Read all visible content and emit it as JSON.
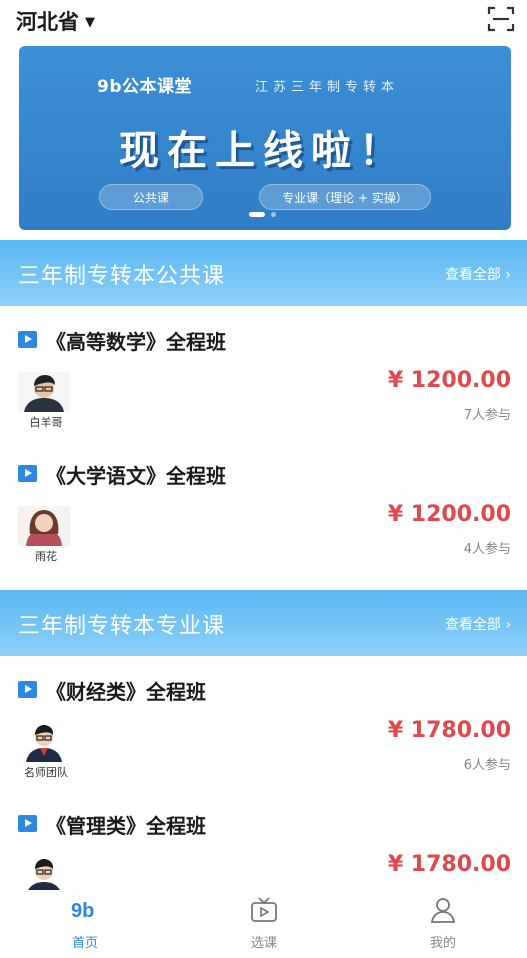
{
  "header": {
    "province": "河北省",
    "icons": {
      "caret": "caret-down-icon",
      "scan": "scan-icon"
    }
  },
  "banner": {
    "logo": "9b公本课堂",
    "subtitle": "江苏三年制专转本",
    "headline": "现在上线啦！",
    "pill_left": "公共课",
    "pill_right": "专业课（理论 + 实操）"
  },
  "sections": [
    {
      "title": "三年制专转本公共课",
      "more": "查看全部 ›",
      "courses": [
        {
          "title": "《高等数学》全程班",
          "teacher": "白羊哥",
          "price": "¥ 1200.00",
          "count": "7人参与"
        },
        {
          "title": "《大学语文》全程班",
          "teacher": "雨花",
          "price": "¥ 1200.00",
          "count": "4人参与"
        }
      ]
    },
    {
      "title": "三年制专转本专业课",
      "more": "查看全部 ›",
      "courses": [
        {
          "title": "《财经类》全程班",
          "teacher": "名师团队",
          "price": "¥ 1780.00",
          "count": "6人参与"
        },
        {
          "title": "《管理类》全程班",
          "teacher": "",
          "price": "¥ 1780.00",
          "count": ""
        }
      ]
    }
  ],
  "nav": {
    "items": [
      {
        "label": "首页",
        "icon": "home-logo-icon",
        "active": true
      },
      {
        "label": "选课",
        "icon": "video-tv-icon",
        "active": false
      },
      {
        "label": "我的",
        "icon": "user-icon",
        "active": false
      }
    ]
  },
  "colors": {
    "accent": "#2b8ae0",
    "price": "#e0484b",
    "section": "#5ab8f3"
  }
}
